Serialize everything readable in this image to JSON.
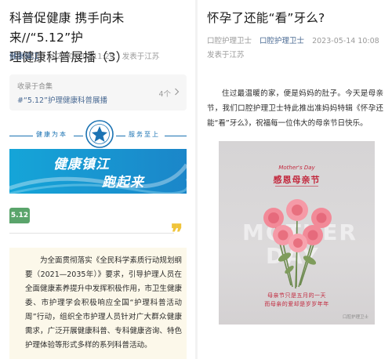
{
  "left": {
    "title_line1": "科普促健康 携手向未来//“5.12”护",
    "title_line2": "理健康科普展播（3）",
    "author": "健康镇江",
    "date": "2023-05-10 11:29",
    "location": "发表于江苏",
    "collection": {
      "label": "收录于合集",
      "tag": "#“5.12”护理健康科普展播",
      "count": "4个"
    },
    "slogan_left": "健康为本",
    "slogan_right": "服务至上",
    "banner_line1": "健康镇江",
    "banner_line2": "跑起来",
    "badge": "5.12",
    "quote_mark": "❞",
    "article": "为全面贯彻落实《全民科学素质行动规划纲要（2021—2035年）》要求，引导护理人员在全面健康素养提升中发挥积极作用，市卫生健康委、市护理学会积极响应全国“护理科普活动周”行动，组织全市护理人员针对广大群众健康需求，广泛开展健康科普、专科健康咨询、特色护理体验等形式多样的系列科普活动。"
  },
  "right": {
    "title": "怀孕了还能“看”牙么?",
    "author": "口腔护理卫士",
    "author_link": "口腔护理卫士",
    "date": "2023-05-14 10:08",
    "location": "发表于江苏",
    "body": "住过最温暖的家，便是妈妈的肚子。今天是母亲节，我们口腔护理卫士特此推出准妈妈特辑《怀孕还能“看”牙么》，祝福每一位伟大的母亲节日快乐。",
    "poster": {
      "english": "Mother's Day",
      "title": "感恩母亲节",
      "bg_word_1": "MOTHER",
      "bg_word_2": "DAY",
      "line1": "母亲节只是五月的一天",
      "line2": "而母亲的爱却是岁岁年年",
      "logo": "口腔护理卫士"
    }
  },
  "colors": {
    "link": "#4a6a93",
    "meta": "#9a9a9a",
    "slogan_blue": "#1b73b3",
    "banner_blue": "#1b86c9",
    "badge_green": "#5aa46b",
    "quote_yellow": "#f0c43a",
    "poster_red": "#c2293e",
    "rose_pink": "#f28a98"
  },
  "icons": {
    "chevron": "chevron-right-icon",
    "emblem": "hospital-emblem-icon",
    "flowers": "pink-rose-bouquet"
  }
}
